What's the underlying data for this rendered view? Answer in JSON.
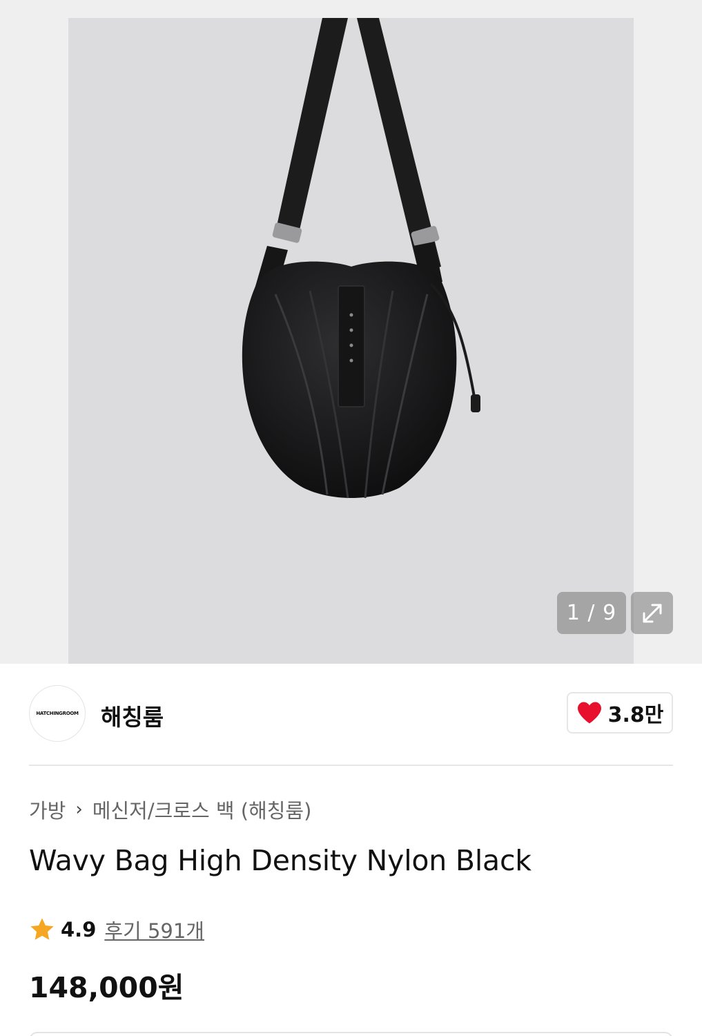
{
  "gallery": {
    "counter": "1 / 9",
    "current_index": 1,
    "total": 9,
    "expand_icon": "expand-icon"
  },
  "brand": {
    "logo_text": "HATCHINGROOM",
    "name": "해칭룸",
    "like_count": "3.8만",
    "like_icon": "heart-icon",
    "heart_color": "#e8112d"
  },
  "breadcrumb": {
    "category": "가방",
    "subcategory": "메신저/크로스 백 (해칭룸)"
  },
  "product": {
    "title": "Wavy Bag High Density Nylon Black",
    "rating": "4.9",
    "reviews": "후기 591개",
    "rating_icon": "star-icon",
    "star_color": "#f5a623",
    "price": "148,000원"
  }
}
